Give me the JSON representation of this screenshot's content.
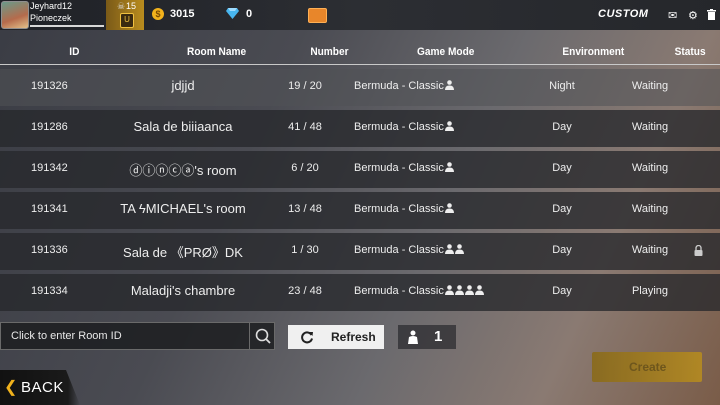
{
  "player": {
    "name": "Jeyhard12",
    "guild": "Pioneczek",
    "level": "15",
    "rank_badge": "U",
    "coins": "3015",
    "diamonds": "0"
  },
  "topbar": {
    "mode_label": "CUSTOM",
    "icons": [
      "mail-icon",
      "gear-icon",
      "trash-icon"
    ]
  },
  "table": {
    "columns": [
      "ID",
      "Room Name",
      "Number",
      "Game Mode",
      "Environment",
      "Status"
    ],
    "rows": [
      {
        "id": "191326",
        "room": "jdjjd",
        "count": "19 / 20",
        "mode": "Bermuda - Classic",
        "players_icons": 1,
        "env": "Night",
        "status": "Waiting",
        "locked": false
      },
      {
        "id": "191286",
        "room": "Sala de biiiaanca",
        "count": "41 / 48",
        "mode": "Bermuda - Classic",
        "players_icons": 1,
        "env": "Day",
        "status": "Waiting",
        "locked": false
      },
      {
        "id": "191342",
        "room": "ⓓⓘⓝⓒⓐ's room",
        "count": "6 / 20",
        "mode": "Bermuda - Classic",
        "players_icons": 1,
        "env": "Day",
        "status": "Waiting",
        "locked": false
      },
      {
        "id": "191341",
        "room": "TA ϟMICHAEL's room",
        "count": "13 / 48",
        "mode": "Bermuda - Classic",
        "players_icons": 1,
        "env": "Day",
        "status": "Waiting",
        "locked": false
      },
      {
        "id": "191336",
        "room": "Sala de 《PRØ》DK",
        "count": "1 / 30",
        "mode": "Bermuda - Classic",
        "players_icons": 2,
        "env": "Day",
        "status": "Waiting",
        "locked": true
      },
      {
        "id": "191334",
        "room": "Maladji's chambre",
        "count": "23 / 48",
        "mode": "Bermuda - Classic",
        "players_icons": 4,
        "env": "Day",
        "status": "Playing",
        "locked": false
      }
    ]
  },
  "search": {
    "placeholder": "Click to enter Room ID",
    "value": ""
  },
  "controls": {
    "refresh_label": "Refresh",
    "player_filter": "1"
  },
  "nav": {
    "back_label": "BACK",
    "create_label": "Create"
  },
  "colors": {
    "accent_gold": "#f1b21c",
    "row_bg": "#26282c"
  }
}
